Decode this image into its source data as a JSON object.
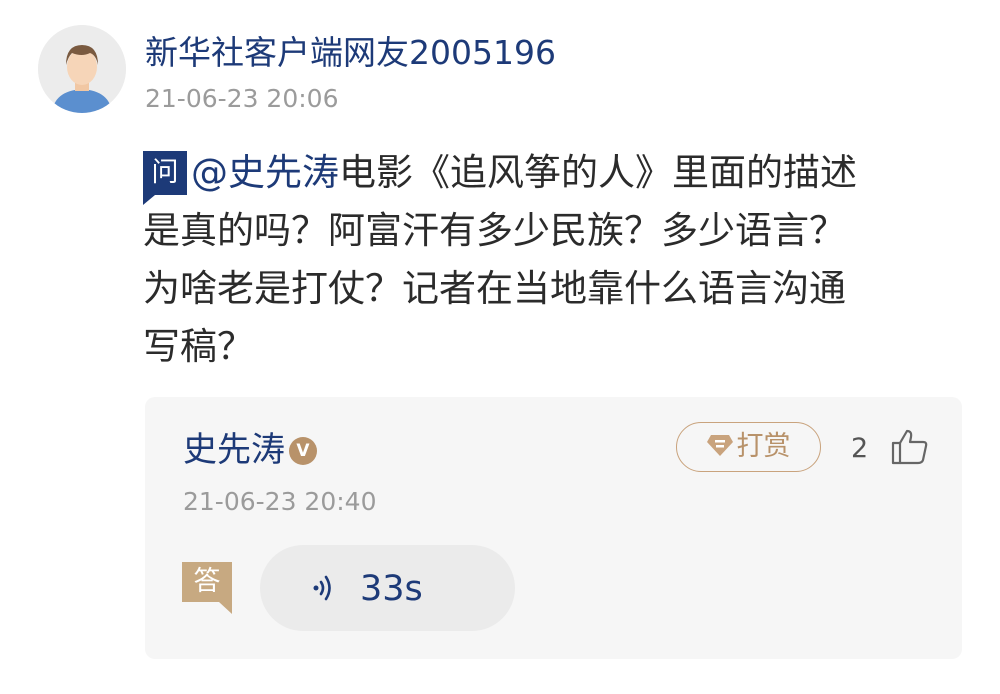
{
  "asker": {
    "name": "新华社客户端网友2005196",
    "time": "21-06-23 20:06",
    "avatar_icon": "user-avatar-icon"
  },
  "question": {
    "badge": "问",
    "mention": "@史先涛",
    "line1_text": "电影《追风筝的人》里面的描述",
    "line2": "是真的吗？阿富汗有多少民族？多少语言？",
    "line3": "为啥老是打仗？记者在当地靠什么语言沟通",
    "line4": "写稿？"
  },
  "answer": {
    "name": "史先涛",
    "verified_badge": "V",
    "time": "21-06-23 20:40",
    "tip_label": "打赏",
    "like_count": "2",
    "badge": "答",
    "audio_duration": "33s"
  },
  "colors": {
    "brand_blue": "#1d3a78",
    "gold": "#c7a981",
    "card_bg": "#f6f6f6",
    "muted": "#9b9b9b"
  }
}
